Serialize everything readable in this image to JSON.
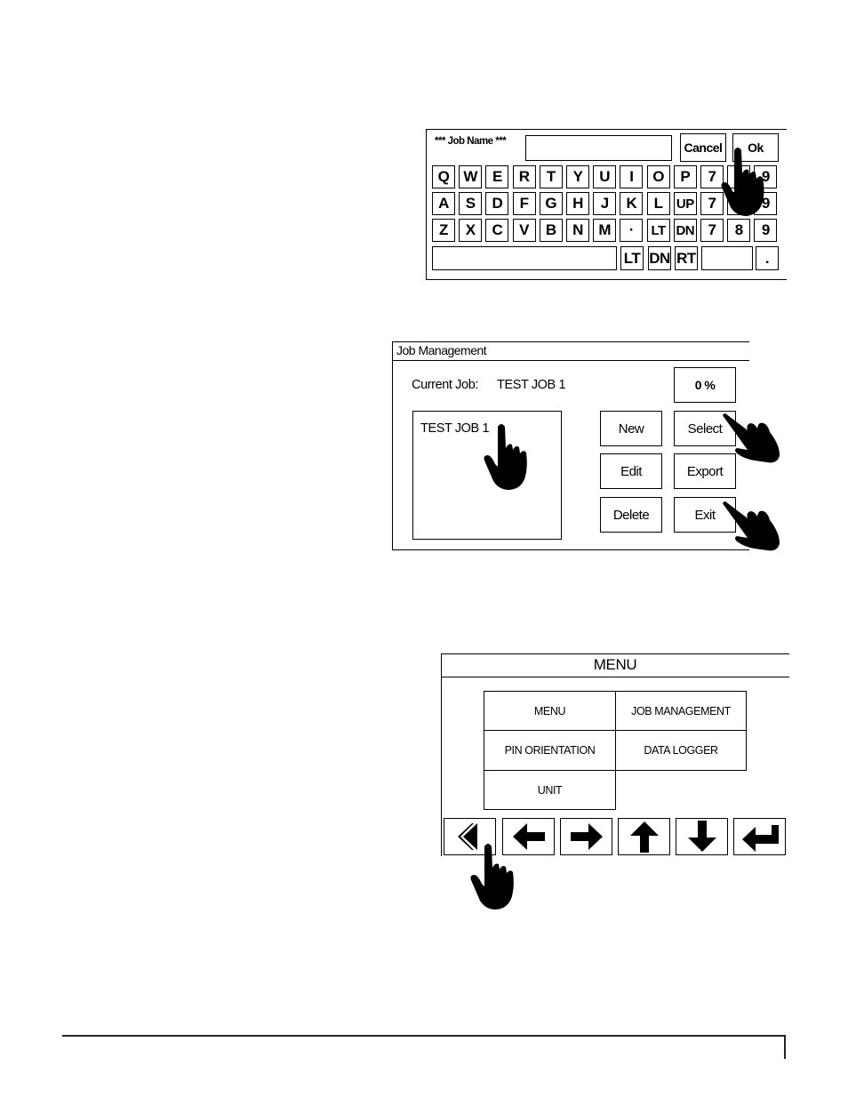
{
  "keyboard_dialog": {
    "title": "*** Job Name ***",
    "input_value": "",
    "cancel_label": "Cancel",
    "ok_label": "Ok",
    "rows": [
      [
        "Q",
        "W",
        "E",
        "R",
        "T",
        "Y",
        "U",
        "I",
        "O",
        "P",
        "7",
        "8",
        "9"
      ],
      [
        "A",
        "S",
        "D",
        "F",
        "G",
        "H",
        "J",
        "K",
        "L",
        "UP",
        "7",
        "8",
        "9"
      ],
      [
        "Z",
        "X",
        "C",
        "V",
        "B",
        "N",
        "M",
        "·",
        "LT",
        "DN",
        "7",
        "8",
        "9"
      ]
    ],
    "bottom_row": {
      "space_label": "",
      "keys": [
        "LT",
        "DN",
        "RT"
      ],
      "blank_label": "",
      "dot_label": "."
    }
  },
  "job_management": {
    "title": "Job Management",
    "current_job_label": "Current Job:",
    "current_job_value": "TEST JOB 1",
    "progress_label": "0 %",
    "job_list": [
      "TEST JOB 1"
    ],
    "buttons": {
      "new": "New",
      "select": "Select",
      "edit": "Edit",
      "export": "Export",
      "delete": "Delete",
      "exit": "Exit"
    }
  },
  "menu_screen": {
    "title": "MENU",
    "items": [
      "MENU",
      "JOB MANAGEMENT",
      "PIN ORIENTATION",
      "DATA LOGGER",
      "UNIT"
    ],
    "nav_buttons": [
      "back-icon",
      "arrow-left-icon",
      "arrow-right-icon",
      "arrow-up-icon",
      "arrow-down-icon",
      "enter-icon"
    ]
  },
  "icons": {
    "pointer_hand": "pointing-hand-icon"
  }
}
